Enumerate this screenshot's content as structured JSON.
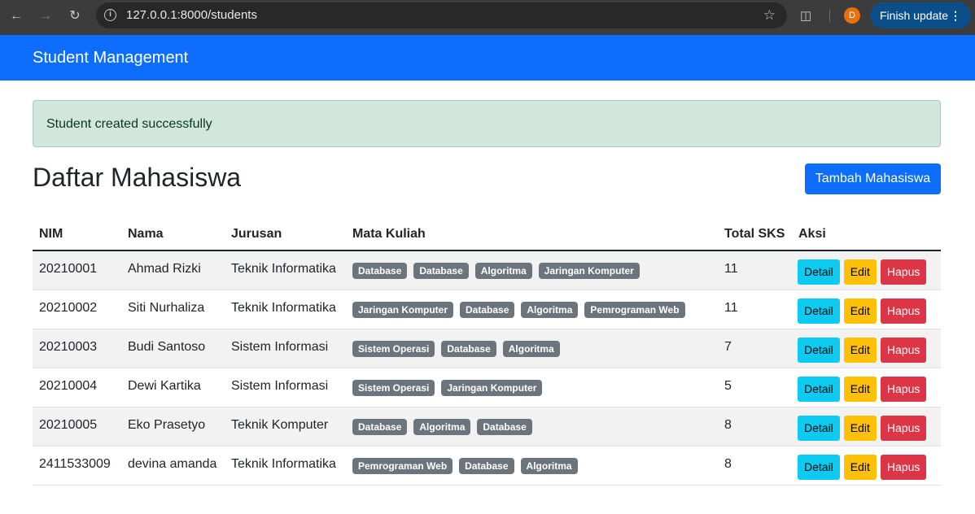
{
  "browser": {
    "url": "127.0.0.1:8000/students",
    "avatar_letter": "D",
    "finish_update_label": "Finish update"
  },
  "navbar": {
    "brand": "Student Management",
    "color": "#0d6efd"
  },
  "alert": {
    "message": "Student created successfully"
  },
  "page": {
    "title": "Daftar Mahasiswa",
    "add_button": "Tambah Mahasiswa"
  },
  "table": {
    "headers": {
      "nim": "NIM",
      "nama": "Nama",
      "jurusan": "Jurusan",
      "mata_kuliah": "Mata Kuliah",
      "total_sks": "Total SKS",
      "aksi": "Aksi"
    },
    "action_labels": {
      "detail": "Detail",
      "edit": "Edit",
      "delete": "Hapus"
    },
    "rows": [
      {
        "nim": "20210001",
        "nama": "Ahmad Rizki",
        "jurusan": "Teknik Informatika",
        "mata_kuliah": [
          "Database",
          "Database",
          "Algoritma",
          "Jaringan Komputer"
        ],
        "total_sks": "11"
      },
      {
        "nim": "20210002",
        "nama": "Siti Nurhaliza",
        "jurusan": "Teknik Informatika",
        "mata_kuliah": [
          "Jaringan Komputer",
          "Database",
          "Algoritma",
          "Pemrograman Web"
        ],
        "total_sks": "11"
      },
      {
        "nim": "20210003",
        "nama": "Budi Santoso",
        "jurusan": "Sistem Informasi",
        "mata_kuliah": [
          "Sistem Operasi",
          "Database",
          "Algoritma"
        ],
        "total_sks": "7"
      },
      {
        "nim": "20210004",
        "nama": "Dewi Kartika",
        "jurusan": "Sistem Informasi",
        "mata_kuliah": [
          "Sistem Operasi",
          "Jaringan Komputer"
        ],
        "total_sks": "5"
      },
      {
        "nim": "20210005",
        "nama": "Eko Prasetyo",
        "jurusan": "Teknik Komputer",
        "mata_kuliah": [
          "Database",
          "Algoritma",
          "Database"
        ],
        "total_sks": "8"
      },
      {
        "nim": "2411533009",
        "nama": "devina amanda",
        "jurusan": "Teknik Informatika",
        "mata_kuliah": [
          "Pemrograman Web",
          "Database",
          "Algoritma"
        ],
        "total_sks": "8"
      }
    ]
  }
}
